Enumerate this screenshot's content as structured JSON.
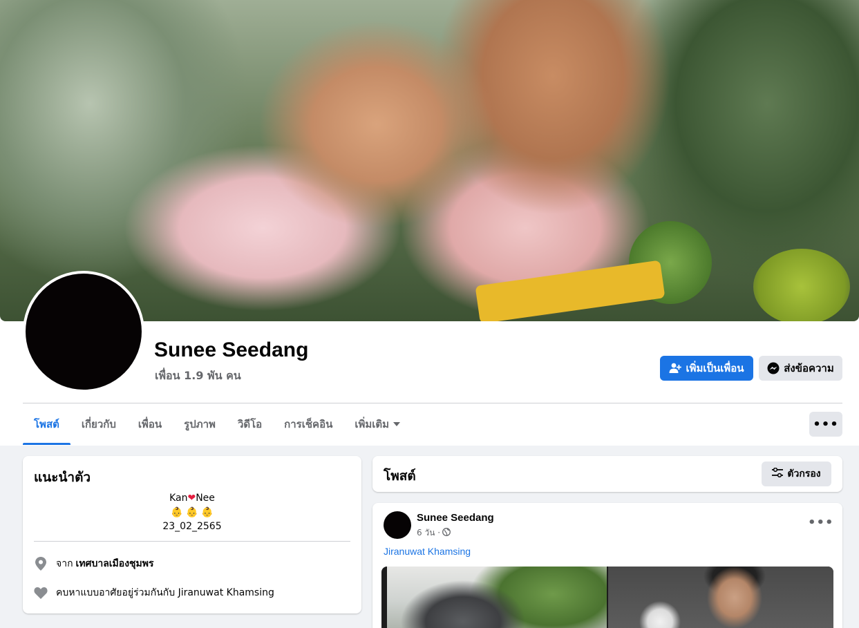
{
  "profile": {
    "name": "Sunee Seedang",
    "friends_count": "เพื่อน 1.9 พัน คน"
  },
  "actions": {
    "add_friend_label": "เพิ่มเป็นเพื่อน",
    "message_label": "ส่งข้อความ",
    "more_label": "•••"
  },
  "tabs": [
    {
      "label": "โพสต์",
      "active": true
    },
    {
      "label": "เกี่ยวกับ",
      "active": false
    },
    {
      "label": "เพื่อน",
      "active": false
    },
    {
      "label": "รูปภาพ",
      "active": false
    },
    {
      "label": "วิดีโอ",
      "active": false
    },
    {
      "label": "การเช็คอิน",
      "active": false
    },
    {
      "label": "เพิ่มเติม",
      "active": false
    }
  ],
  "intro": {
    "title": "แนะนำตัว",
    "bio_line1_a": "Kan",
    "bio_line1_heart": "❤",
    "bio_line1_b": "Nee",
    "bio_line2": "👶 👶 👶",
    "bio_line3": "23_02_2565",
    "location_prefix": "จาก",
    "location_name": "เทศบาลเมืองชุมพร",
    "relationship": "คบหาแบบอาศัยอยู่ร่วมกันกับ Jiranuwat Khamsing"
  },
  "posts_section": {
    "title": "โพสต์",
    "filter_label": "ตัวกรอง"
  },
  "post": {
    "author": "Sunee Seedang",
    "time": "6 วัน ·",
    "tag": "Jiranuwat Khamsing",
    "more_label": "•••"
  },
  "colors": {
    "accent": "#1b74e4",
    "background": "#f0f2f5",
    "button_secondary": "#e4e6eb"
  },
  "icons": {
    "add_friend": "add-person-icon",
    "message": "messenger-icon",
    "filter": "filter-icon",
    "location": "location-pin-icon",
    "relationship": "heart-icon",
    "privacy": "globe-icon"
  }
}
